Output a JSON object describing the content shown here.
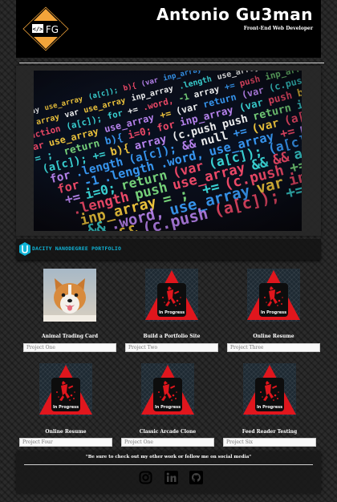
{
  "header": {
    "name": "Antonio Gu3man",
    "role": "Front-End Web Developer",
    "logo_icon": "fg-logo-icon",
    "logo_text": "</> FG"
  },
  "hero": {
    "icon": "code-screen-image"
  },
  "udacity": {
    "label": "DACITY NANODEGREE PORTFOLIO",
    "icon": "udacity-logo-icon",
    "color": "#0fb3d6"
  },
  "projects": [
    {
      "title": "Animal Trading Card",
      "placeholder": "Project One",
      "thumb": "corgi-photo"
    },
    {
      "title": "Build a Portfolio Site",
      "placeholder": "Project Two",
      "thumb": "in-progress-icon"
    },
    {
      "title": "Online Resume",
      "placeholder": "Project Three",
      "thumb": "in-progress-icon"
    },
    {
      "title": "Online Resume",
      "placeholder": "Project Four",
      "thumb": "in-progress-icon"
    },
    {
      "title": "Classic Arcade Clone",
      "placeholder": "Project One",
      "thumb": "in-progress-icon"
    },
    {
      "title": "Feed Reader Testing",
      "placeholder": "Project Six",
      "thumb": "in-progress-icon"
    }
  ],
  "in_progress_label": "In Progress",
  "footer": {
    "text": "\"Be sure to check out my other work or follow me on social media\"",
    "social": [
      "instagram-icon",
      "linkedin-icon",
      "github-icon"
    ]
  },
  "colors": {
    "accent": "#e0161d",
    "header_bg": "#000000",
    "logo_orange": "#f2a43a"
  }
}
